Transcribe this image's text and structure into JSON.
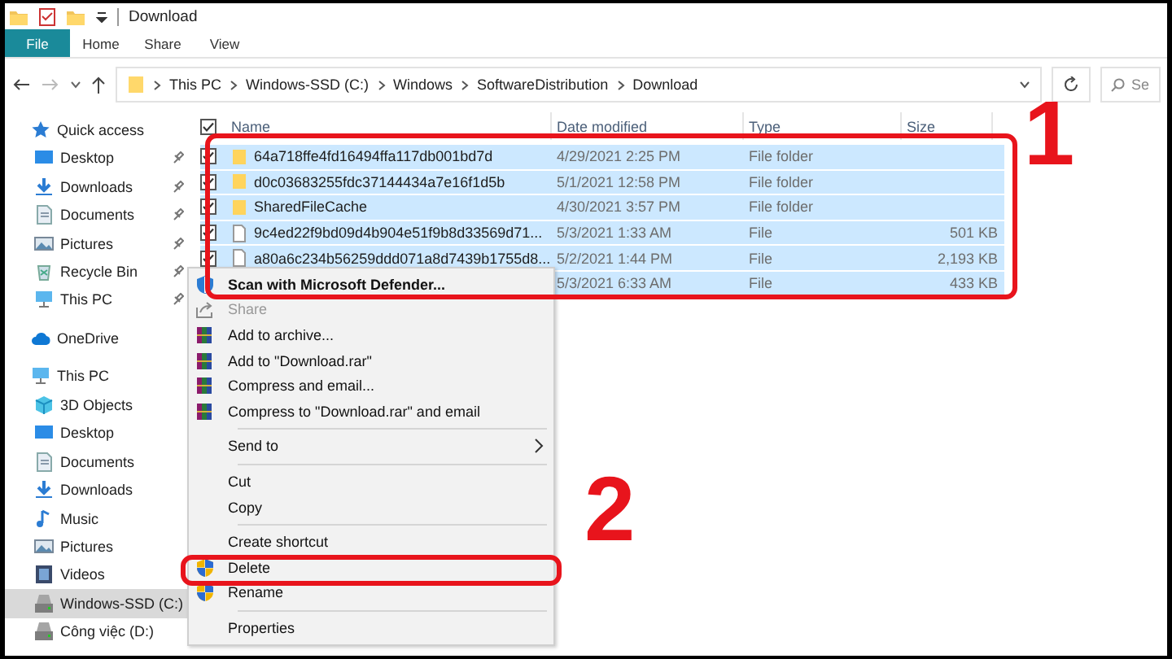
{
  "window": {
    "title": "Download"
  },
  "ribbon_tabs": [
    {
      "label": "File",
      "selected": true
    },
    {
      "label": "Home",
      "selected": false
    },
    {
      "label": "Share",
      "selected": false
    },
    {
      "label": "View",
      "selected": false
    }
  ],
  "address": {
    "path": [
      "This PC",
      "Windows-SSD (C:)",
      "Windows",
      "SoftwareDistribution",
      "Download"
    ],
    "search_placeholder": "Se"
  },
  "sidebar": {
    "items": [
      {
        "label": "Quick access",
        "kind": "star",
        "pinned": false,
        "selected": false,
        "children": [
          {
            "label": "Desktop",
            "kind": "desktop",
            "pinned": true,
            "selected": false
          },
          {
            "label": "Downloads",
            "kind": "downloads",
            "pinned": true,
            "selected": false
          },
          {
            "label": "Documents",
            "kind": "documents",
            "pinned": true,
            "selected": false
          },
          {
            "label": "Pictures",
            "kind": "pictures",
            "pinned": true,
            "selected": false
          },
          {
            "label": "Recycle Bin",
            "kind": "recycle",
            "pinned": true,
            "selected": false
          },
          {
            "label": "This PC",
            "kind": "pc",
            "pinned": true,
            "selected": false
          }
        ]
      },
      {
        "label": "OneDrive",
        "kind": "cloud",
        "pinned": false,
        "selected": false
      },
      {
        "label": "This PC",
        "kind": "pc",
        "pinned": false,
        "selected": false,
        "children": [
          {
            "label": "3D Objects",
            "kind": "cube",
            "pinned": false,
            "selected": false
          },
          {
            "label": "Desktop",
            "kind": "desktop",
            "pinned": false,
            "selected": false
          },
          {
            "label": "Documents",
            "kind": "documents",
            "pinned": false,
            "selected": false
          },
          {
            "label": "Downloads",
            "kind": "downloads",
            "pinned": false,
            "selected": false
          },
          {
            "label": "Music",
            "kind": "music",
            "pinned": false,
            "selected": false
          },
          {
            "label": "Pictures",
            "kind": "pictures",
            "pinned": false,
            "selected": false
          },
          {
            "label": "Videos",
            "kind": "videos",
            "pinned": false,
            "selected": false
          },
          {
            "label": "Windows-SSD (C:)",
            "kind": "drive",
            "pinned": false,
            "selected": true
          },
          {
            "label": "Công việc (D:)",
            "kind": "drive",
            "pinned": false,
            "selected": false
          }
        ]
      }
    ]
  },
  "files": {
    "header_checked": true,
    "columns": [
      "Name",
      "Date modified",
      "Type",
      "Size"
    ],
    "rows": [
      {
        "name": "64a718ffe4fd16494ffa117db001bd7d",
        "kind": "folder",
        "date": "4/29/2021 2:25 PM",
        "type": "File folder",
        "selected": true
      },
      {
        "name": "d0c03683255fdc37144434a7e16f1d5b",
        "kind": "folder",
        "date": "5/1/2021 12:58 PM",
        "type": "File folder",
        "selected": true
      },
      {
        "name": "SharedFileCache",
        "kind": "folder",
        "date": "4/30/2021 3:57 PM",
        "type": "File folder",
        "selected": true
      },
      {
        "name": "9c4ed22f9bd09d4b904e51f9b8d33569d71...",
        "kind": "file",
        "date": "5/3/2021 1:33 AM",
        "type": "File",
        "size": "501 KB",
        "selected": true
      },
      {
        "name": "a80a6c234b56259ddd071a8d7439b1755d8...",
        "kind": "file",
        "date": "5/2/2021 1:44 PM",
        "type": "File",
        "size": "2,193 KB",
        "selected": true
      },
      {
        "date": "5/3/2021 6:33 AM",
        "type": "File",
        "size": "433 KB",
        "selected": true
      }
    ]
  },
  "context_menu": {
    "items": [
      {
        "kind": "defender",
        "label": "Scan with Microsoft Defender...",
        "bold": true,
        "disabled": false
      },
      {
        "kind": "share",
        "label": "Share",
        "bold": false,
        "disabled": true
      },
      {
        "kind": "archive",
        "label": "Add to archive...",
        "bold": false,
        "disabled": false
      },
      {
        "kind": "archive",
        "label": "Add to \"Download.rar\"",
        "bold": false,
        "disabled": false
      },
      {
        "kind": "archive",
        "label": "Compress and email...",
        "bold": false,
        "disabled": false
      },
      {
        "kind": "archive",
        "label": "Compress to \"Download.rar\" and email",
        "bold": false,
        "disabled": false
      },
      {
        "kind": "separator"
      },
      {
        "kind": "submenu",
        "label": "Send to"
      },
      {
        "kind": "separator"
      },
      {
        "kind": "item",
        "label": "Cut",
        "bold": false,
        "disabled": false
      },
      {
        "kind": "item",
        "label": "Copy",
        "bold": false,
        "disabled": false
      },
      {
        "kind": "separator"
      },
      {
        "kind": "item",
        "label": "Create shortcut",
        "bold": false,
        "disabled": false
      },
      {
        "kind": "shield",
        "label": "Delete",
        "bold": false,
        "disabled": false
      },
      {
        "kind": "shield",
        "label": "Rename",
        "bold": false,
        "disabled": false
      },
      {
        "kind": "separator"
      },
      {
        "kind": "item",
        "label": "Properties",
        "bold": false,
        "disabled": false
      }
    ]
  },
  "annotations": [
    {
      "label": "1"
    },
    {
      "label": "2"
    }
  ]
}
